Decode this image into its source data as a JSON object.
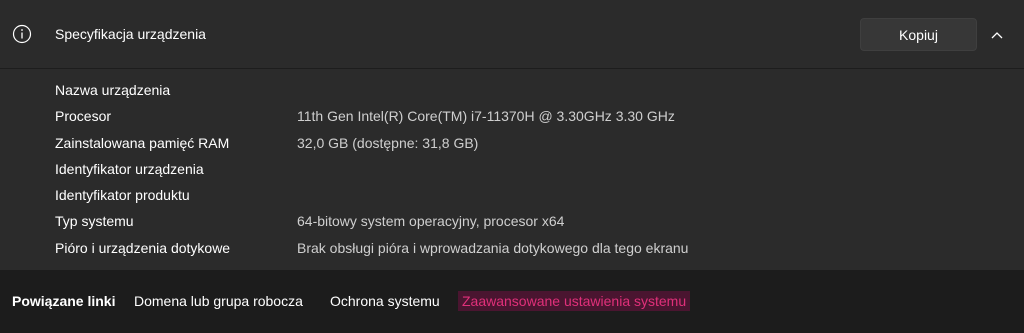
{
  "header": {
    "title": "Specyfikacja urządzenia",
    "copy_label": "Kopiuj",
    "info_icon": "info-icon",
    "collapse_icon": "chevron-up-icon"
  },
  "specs": [
    {
      "label": "Nazwa urządzenia",
      "value": ""
    },
    {
      "label": "Procesor",
      "value": "11th Gen Intel(R) Core(TM) i7-11370H @ 3.30GHz   3.30 GHz"
    },
    {
      "label": "Zainstalowana pamięć RAM",
      "value": "32,0 GB (dostępne: 31,8 GB)"
    },
    {
      "label": "Identyfikator urządzenia",
      "value": ""
    },
    {
      "label": "Identyfikator produktu",
      "value": ""
    },
    {
      "label": "Typ systemu",
      "value": "64-bitowy system operacyjny, procesor x64"
    },
    {
      "label": "Pióro i urządzenia dotykowe",
      "value": "Brak obsługi pióra i wprowadzania dotykowego dla tego ekranu"
    }
  ],
  "related_links": {
    "heading": "Powiązane linki",
    "links": [
      "Domena lub grupa robocza",
      "Ochrona systemu",
      "Zaawansowane ustawienia systemu"
    ],
    "highlight_color": "#e0307a"
  }
}
